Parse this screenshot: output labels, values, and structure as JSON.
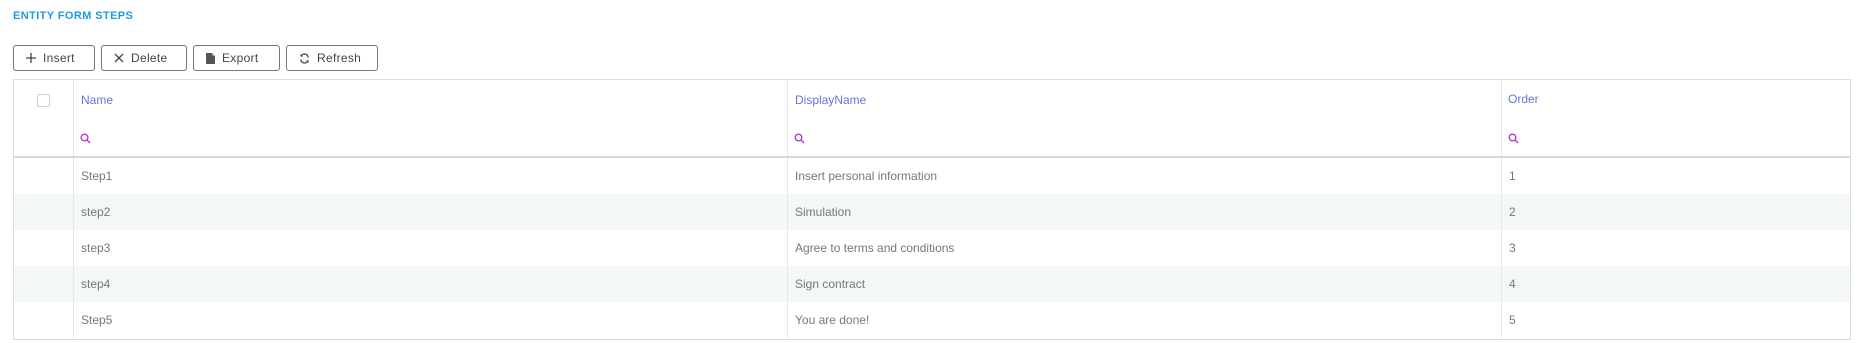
{
  "page": {
    "title": "ENTITY FORM STEPS"
  },
  "toolbar": {
    "insert_label": "Insert",
    "delete_label": "Delete",
    "export_label": "Export",
    "refresh_label": "Refresh"
  },
  "icons": {
    "insert": "plus-icon",
    "delete": "close-icon",
    "export": "document-icon",
    "refresh": "refresh-icon",
    "filter": "search-icon"
  },
  "colors": {
    "title": "#1e9be0",
    "header_text": "#6a75d6",
    "search_icon": "#b040c8",
    "alt_row": "#f3f7f8"
  },
  "grid": {
    "columns": [
      "Name",
      "DisplayName",
      "Order"
    ],
    "rows": [
      {
        "name": "Step1",
        "display_name": "Insert personal information",
        "order": "1"
      },
      {
        "name": "step2",
        "display_name": "Simulation",
        "order": "2"
      },
      {
        "name": "step3",
        "display_name": "Agree to terms and conditions",
        "order": "3"
      },
      {
        "name": "step4",
        "display_name": "Sign contract",
        "order": "4"
      },
      {
        "name": "Step5",
        "display_name": "You are done!",
        "order": "5"
      }
    ]
  }
}
